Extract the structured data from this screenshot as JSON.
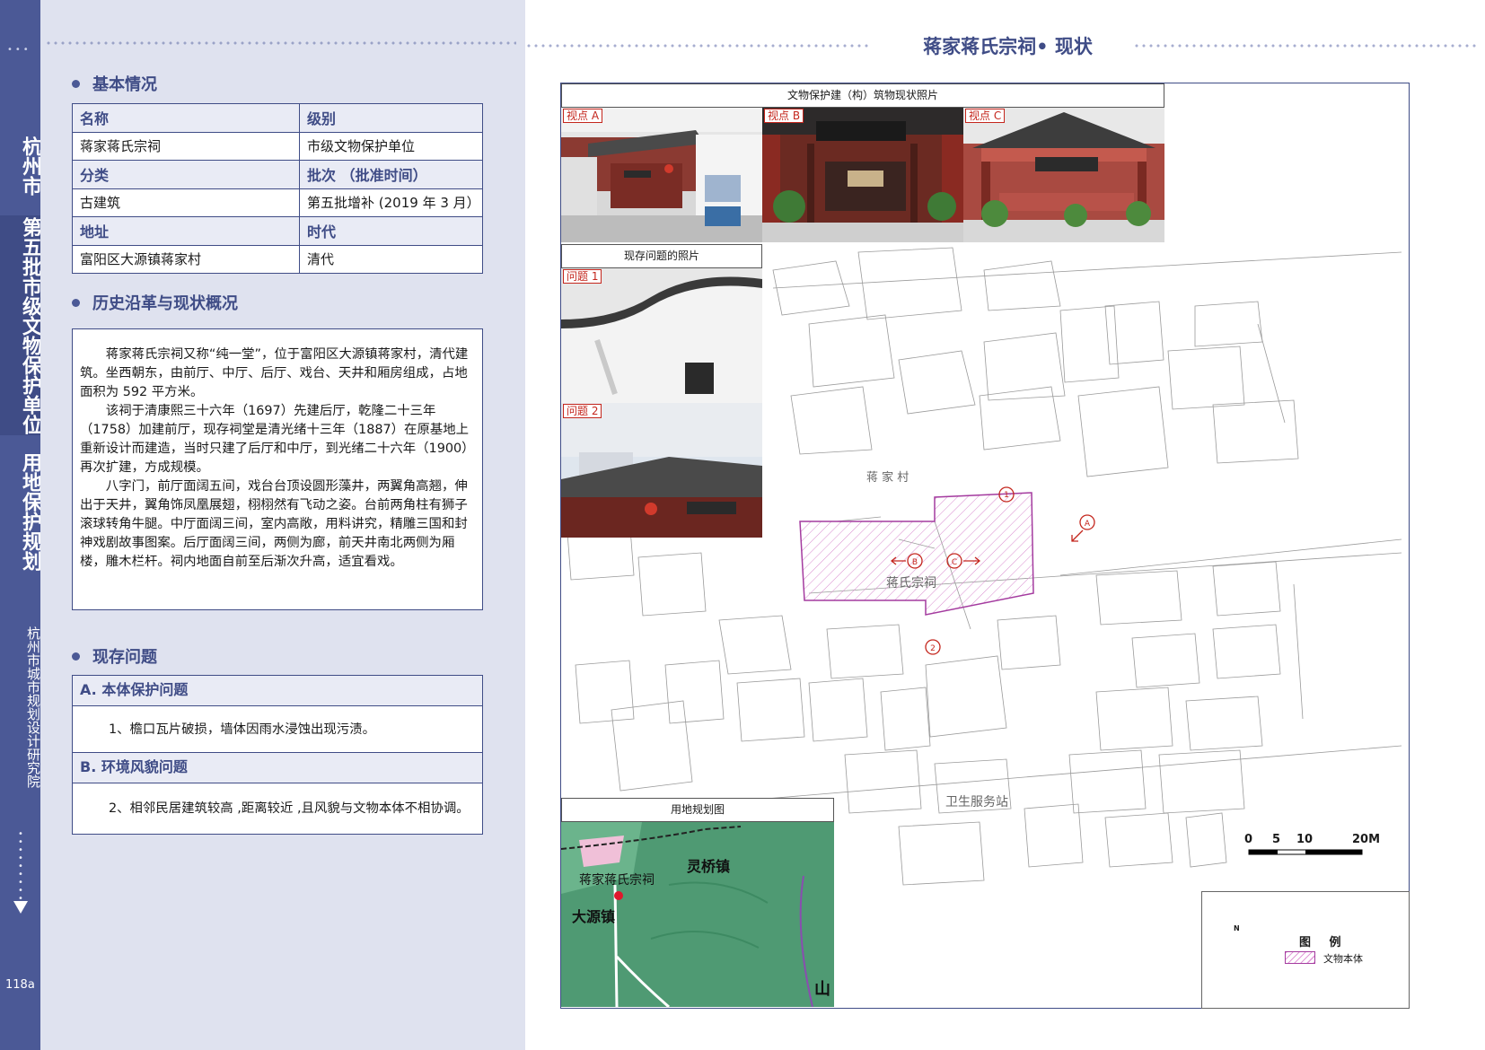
{
  "sidebar": {
    "city": "杭州市",
    "series": "第五批市级文物保护单位",
    "section": "用地保护规划",
    "institute": "杭州市城市规划设计研究院",
    "page": "118a"
  },
  "left": {
    "basic_title": "基本情况",
    "table": {
      "h_name": "名称",
      "h_level": "级别",
      "name": "蒋家蒋氏宗祠",
      "level": "市级文物保护单位",
      "h_category": "分类",
      "h_batch": "批次 （批准时间）",
      "category": "古建筑",
      "batch": "第五批增补 (2019 年 3 月）",
      "h_address": "地址",
      "h_era": "时代",
      "address": "富阳区大源镇蒋家村",
      "era": "清代"
    },
    "history_title": "历史沿革与现状概况",
    "history": [
      "蒋家蒋氏宗祠又称“纯一堂”，位于富阳区大源镇蒋家村，清代建筑。坐西朝东，由前厅、中厅、后厅、戏台、天井和厢房组成，占地面积为 592 平方米。",
      "该祠于清康熙三十六年（1697）先建后厅，乾隆二十三年（1758）加建前厅，现存祠堂是清光绪十三年（1887）在原基地上重新设计而建造，当时只建了后厅和中厅，到光绪二十六年（1900）再次扩建，方成规模。",
      "八字门，前厅面阔五间，戏台台顶设圆形藻井，两翼角高翘，伸出于天井，翼角饰凤凰展翅，栩栩然有飞动之姿。台前两角柱有狮子滚球转角牛腿。中厅面阔三间，室内高敞，用料讲究，精雕三国和封神戏剧故事图案。后厅面阔三间，两侧为廊，前天井南北两侧为厢楼，雕木栏杆。祠内地面自前至后渐次升高，适宜看戏。"
    ],
    "issues_title": "现存问题",
    "issue_a_head": "A. 本体保护问题",
    "issue_a_text": "1、檐口瓦片破损，墙体因雨水浸蚀出现污渍。",
    "issue_b_head": "B. 环境风貌问题",
    "issue_b_text": "2、相邻民居建筑较高 ,距离较近 ,且风貌与文物本体不相协调。"
  },
  "right": {
    "page_title": "蒋家蒋氏宗祠• 现状",
    "photos_caption": "文物保护建（构）筑物现状照片",
    "view_a": "视点 A",
    "view_b": "视点 B",
    "view_c": "视点 C",
    "problems_caption": "现存问题的照片",
    "problem_1": "问题 1",
    "problem_2": "问题 2",
    "landuse_caption": "用地规划图",
    "landuse_site": "蒋家蒋氏宗祠",
    "landuse_town1": "灵桥镇",
    "landuse_town2": "大源镇",
    "landuse_mark": "山",
    "map_village": "蒋 家 村",
    "map_site": "蒋氏宗祠",
    "map_clinic": "卫生服务站",
    "scale": [
      "0",
      "5",
      "10",
      "20M"
    ],
    "legend_title": "图 例",
    "legend_item": "文物本体",
    "north": "N"
  },
  "colors": {
    "accent": "#3f4c86",
    "sidebar": "#4b5996",
    "panel": "#dfe2ef",
    "site_hatch": "#a43b9f",
    "marker": "#c4261d"
  }
}
